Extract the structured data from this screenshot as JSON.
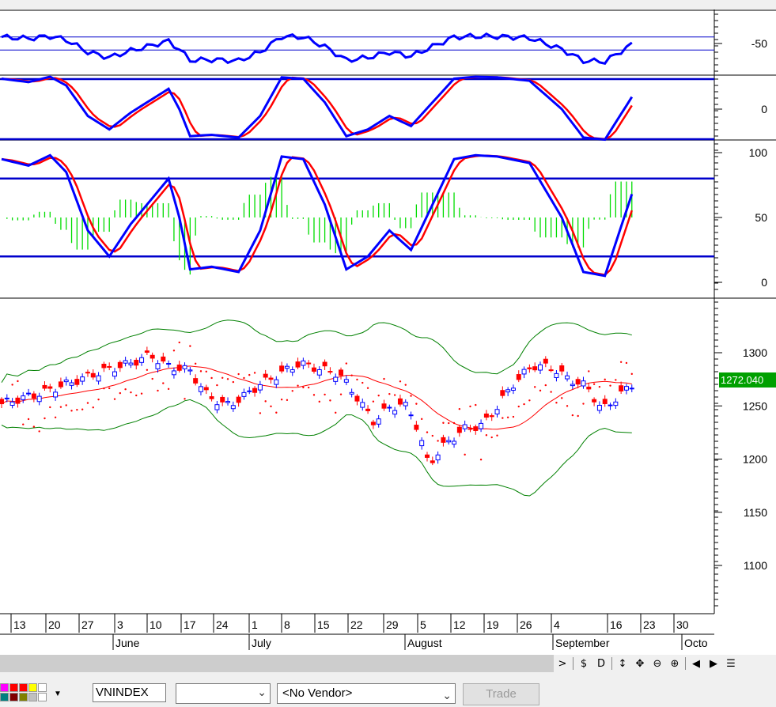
{
  "toolbar": {
    "symbol": "VNINDEX",
    "combo_empty": "",
    "vendor": "<No Vendor>",
    "trade_label": "Trade",
    "swatch_colors": [
      "#ff00ff",
      "#ff0000",
      "#ff0000",
      "#ffff00",
      "#ffffff",
      "#008080",
      "#800000",
      "#808000",
      "#c0c0c0",
      "#ffffff"
    ]
  },
  "nav": {
    "next": ">",
    "dollar": "$",
    "d": "D",
    "vzoom": "↕",
    "move": "✥",
    "zoom_out": "⊖",
    "zoom_in": "⊕",
    "prev_bar": "◀",
    "next_bar": "▶",
    "menu": "☰"
  },
  "chart_data": {
    "type": "candlestick",
    "last_price": "1272.040",
    "colors": {
      "up": "#0000ff",
      "down": "#ff0000",
      "bands": "#008000",
      "ma": "#ff0000",
      "stoch_k": "#0000ff",
      "stoch_d": "#ff0000",
      "histogram": "#00dd00"
    },
    "x_ticks": [
      "13",
      "20",
      "27",
      "3",
      "10",
      "17",
      "24",
      "1",
      "8",
      "15",
      "22",
      "29",
      "5",
      "12",
      "19",
      "26",
      "4",
      "16",
      "23",
      "30"
    ],
    "months": [
      "June",
      "July",
      "August",
      "September",
      "Octo"
    ],
    "panels": [
      {
        "name": "oscillator-1",
        "ticks": [
          "-50"
        ],
        "ylim": [
          -100,
          0
        ],
        "levels": [
          -40,
          -60
        ]
      },
      {
        "name": "oscillator-2",
        "ticks": [
          "0"
        ],
        "ylim": [
          -40,
          40
        ],
        "levels": [
          20,
          -20
        ]
      },
      {
        "name": "stochastic",
        "ticks": [
          "100",
          "50",
          "0"
        ],
        "ylim": [
          -5,
          110
        ],
        "levels": [
          80,
          20
        ]
      },
      {
        "name": "price",
        "ticks": [
          "1300",
          "1250",
          "1200",
          "1150",
          "1100"
        ],
        "ylim": [
          1060,
          1345
        ]
      }
    ]
  }
}
